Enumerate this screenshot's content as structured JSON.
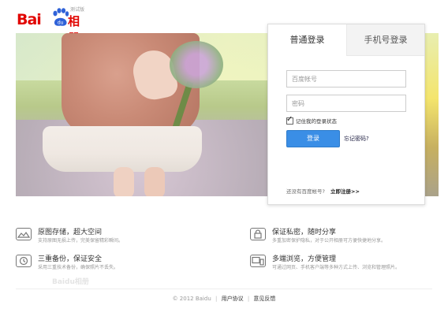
{
  "header": {
    "logo_text": "Bai",
    "logo_du": "du",
    "product_name": "相册",
    "beta_label": "测试版"
  },
  "login": {
    "tabs": [
      {
        "label": "普通登录",
        "active": true
      },
      {
        "label": "手机号登录",
        "active": false
      }
    ],
    "username_placeholder": "百度帐号",
    "password_placeholder": "密码",
    "remember_label": "记住我的登录状态",
    "remember_checked": true,
    "submit_label": "登录",
    "forgot_label": "忘记密码?",
    "register_prompt": "还没有百度帐号?",
    "register_link": "立即注册>>"
  },
  "features": [
    {
      "icon": "photo-frame-icon",
      "title": "原图存储，超大空间",
      "desc": "支持原图无损上传，完美保留精彩瞬间。"
    },
    {
      "icon": "lock-icon",
      "title": "保证私密，随时分享",
      "desc": "多重加密保护隐私，对于公开相册可方便快捷地分享。"
    },
    {
      "icon": "backup-icon",
      "title": "三重备份，保证安全",
      "desc": "采用三重技术备份，确保照片不丢失。"
    },
    {
      "icon": "devices-icon",
      "title": "多端浏览，方便管理",
      "desc": "可通过网页、手机客户端等多种方式上传、浏览和管理照片。"
    }
  ],
  "watermark_text": "Baidu相册",
  "footer": {
    "copyright": "© 2012 Baidu",
    "user_agreement": "用户协议",
    "feedback": "意见反馈"
  },
  "colors": {
    "brand_red": "#e10602",
    "brand_blue": "#2f62d8",
    "button_blue": "#3a8ee6"
  }
}
